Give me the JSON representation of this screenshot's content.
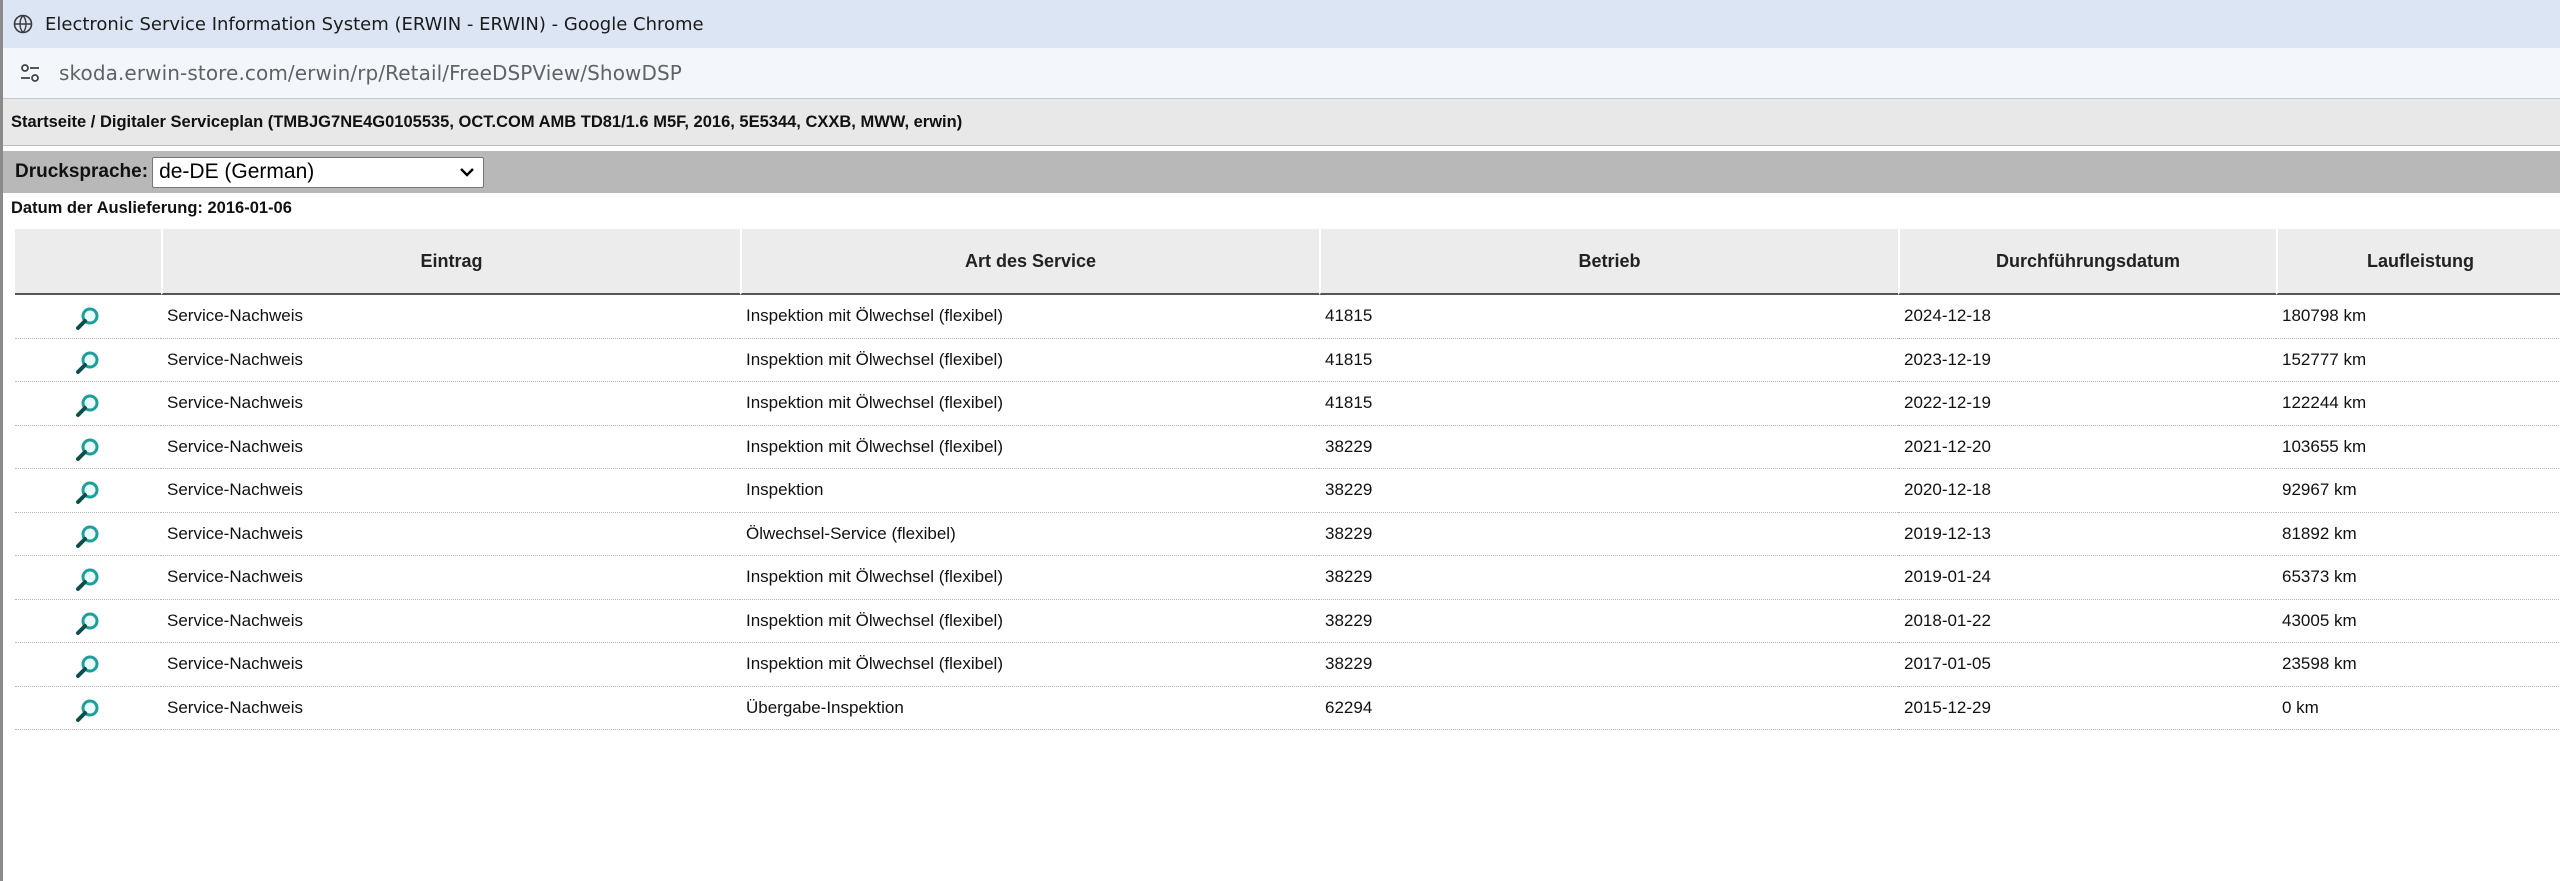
{
  "browser": {
    "window_title": "Electronic Service Information System (ERWIN - ERWIN) - Google Chrome",
    "url": "skoda.erwin-store.com/erwin/rp/Retail/FreeDSPView/ShowDSP"
  },
  "breadcrumb": "Startseite / Digitaler Serviceplan (TMBJG7NE4G0105535, OCT.COM AMB TD81/1.6 M5F, 2016, 5E5344, CXXB, MWW, erwin)",
  "print_language": {
    "label": "Drucksprache:",
    "selected": "de-DE (German)"
  },
  "delivery_date": "Datum der Auslieferung: 2016-01-06",
  "table": {
    "columns": [
      "",
      "Eintrag",
      "Art des Service",
      "Betrieb",
      "Durchführungsdatum",
      "Laufleistung"
    ],
    "rows": [
      {
        "entry": "Service-Nachweis",
        "service": "Inspektion mit Ölwechsel (flexibel)",
        "dealer": "41815",
        "date": "2024-12-18",
        "mileage": "180798 km"
      },
      {
        "entry": "Service-Nachweis",
        "service": "Inspektion mit Ölwechsel (flexibel)",
        "dealer": "41815",
        "date": "2023-12-19",
        "mileage": "152777 km"
      },
      {
        "entry": "Service-Nachweis",
        "service": "Inspektion mit Ölwechsel (flexibel)",
        "dealer": "41815",
        "date": "2022-12-19",
        "mileage": "122244 km"
      },
      {
        "entry": "Service-Nachweis",
        "service": "Inspektion mit Ölwechsel (flexibel)",
        "dealer": "38229",
        "date": "2021-12-20",
        "mileage": "103655 km"
      },
      {
        "entry": "Service-Nachweis",
        "service": "Inspektion",
        "dealer": "38229",
        "date": "2020-12-18",
        "mileage": "92967 km"
      },
      {
        "entry": "Service-Nachweis",
        "service": "Ölwechsel-Service (flexibel)",
        "dealer": "38229",
        "date": "2019-12-13",
        "mileage": "81892 km"
      },
      {
        "entry": "Service-Nachweis",
        "service": "Inspektion mit Ölwechsel (flexibel)",
        "dealer": "38229",
        "date": "2019-01-24",
        "mileage": "65373 km"
      },
      {
        "entry": "Service-Nachweis",
        "service": "Inspektion mit Ölwechsel (flexibel)",
        "dealer": "38229",
        "date": "2018-01-22",
        "mileage": "43005 km"
      },
      {
        "entry": "Service-Nachweis",
        "service": "Inspektion mit Ölwechsel (flexibel)",
        "dealer": "38229",
        "date": "2017-01-05",
        "mileage": "23598 km"
      },
      {
        "entry": "Service-Nachweis",
        "service": "Übergabe-Inspektion",
        "dealer": "62294",
        "date": "2015-12-29",
        "mileage": "0 km"
      }
    ],
    "row_icon": "magnifier-icon"
  },
  "colors": {
    "titlebar_bg": "#dbe5f4",
    "breadcrumb_bg": "#e8e8e8",
    "lang_bar_bg": "#b8b8b8",
    "header_bg": "#ececec",
    "magnifier_teal": "#1f9e9a"
  }
}
